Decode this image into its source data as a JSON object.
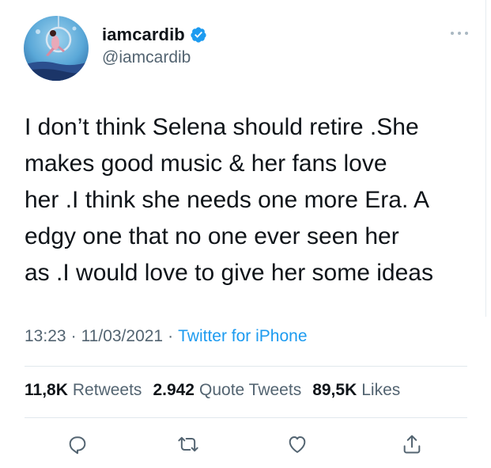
{
  "author": {
    "display_name": "iamcardib",
    "handle": "@iamcardib",
    "verified": true,
    "avatar_icon": "profile-photo"
  },
  "tweet": {
    "lines": [
      "I don’t think Selena should retire .She",
      "makes good music & her fans love",
      "her .I think she needs one more Era. A",
      "edgy one that no one ever seen her",
      "as .I would love to give her some ideas"
    ]
  },
  "meta": {
    "time": "13:23",
    "date": "11/03/2021",
    "separator": "·",
    "source": "Twitter for iPhone"
  },
  "stats": {
    "retweets_count": "11,8K",
    "retweets_label": "Retweets",
    "quotes_count": "2.942",
    "quotes_label": "Quote Tweets",
    "likes_count": "89,5K",
    "likes_label": "Likes"
  },
  "actions": [
    {
      "name": "reply",
      "icon": "reply-icon"
    },
    {
      "name": "retweet",
      "icon": "retweet-icon"
    },
    {
      "name": "like",
      "icon": "heart-icon"
    },
    {
      "name": "share",
      "icon": "share-icon"
    }
  ],
  "colors": {
    "text": "#0f1419",
    "secondary": "#536471",
    "accent": "#1d9bf0",
    "divider": "#e1e8ed",
    "icon": "#536471"
  }
}
